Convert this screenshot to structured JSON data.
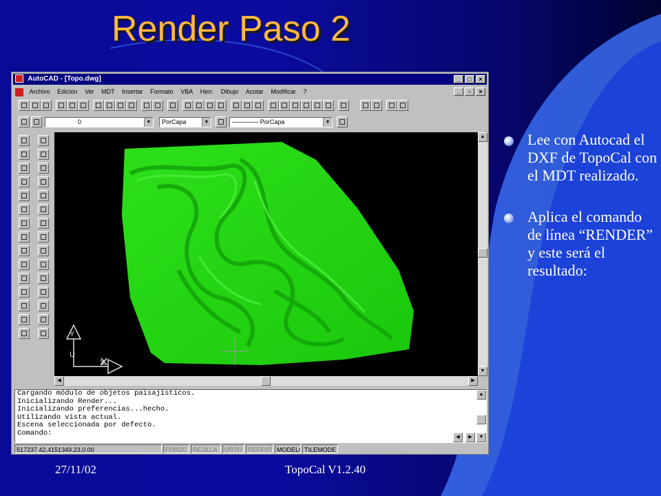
{
  "slide": {
    "title": "Render Paso 2",
    "bullets": [
      "Lee con Autocad el DXF de TopoCal con el MDT realizado.",
      "Aplica el comando de línea “RENDER” y este será el resultado:"
    ],
    "footer": {
      "date": "27/11/02",
      "center": "TopoCal V1.2.40"
    }
  },
  "autocad": {
    "window_title": "AutoCAD - [Topo.dwg]",
    "menu": [
      "Archivo",
      "Edición",
      "Ver",
      "MDT",
      "Insertar",
      "Formato",
      "VBA",
      "Herr.",
      "Dibujo",
      "Acotar",
      "Modificar",
      "?"
    ],
    "layer_value": "0",
    "color_value": "PorCapa",
    "linetype_value": "PorCapa",
    "command_history": [
      "Cargando módulo de objetos paisajísticos.",
      "Inicializando Render...",
      "Inicializando preferencias...hecho.",
      "Utilizando vista actual.",
      "Escena seleccionada por defecto."
    ],
    "command_prompt": "Comando:",
    "coordinates": "517237.42,4151349.23,0.00",
    "status_toggles": [
      {
        "label": "FORZC",
        "on": false
      },
      {
        "label": "REJILLA",
        "on": false
      },
      {
        "label": "ORTO",
        "on": false
      },
      {
        "label": "REFENT",
        "on": false
      },
      {
        "label": "MODELO",
        "on": true
      },
      {
        "label": "TILEMODE",
        "on": true
      }
    ],
    "ucs_labels": {
      "y": "Y",
      "u": "U",
      "x": "X"
    }
  },
  "colors": {
    "title": "#ffb840",
    "render_green": "#22dd11",
    "slide_blue": "#0a0a96",
    "swoosh_blue": "#3a6cf0"
  }
}
